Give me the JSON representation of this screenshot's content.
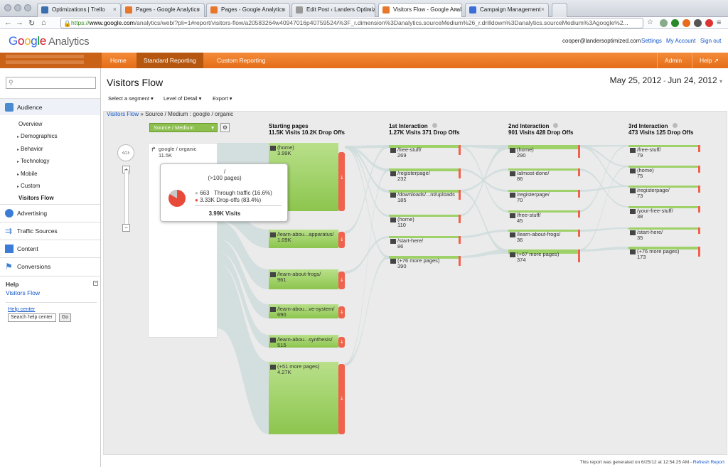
{
  "browser": {
    "tabs": [
      {
        "title": "Optimizations | Trello",
        "color": "#3a6fb0"
      },
      {
        "title": "Pages - Google Analytics",
        "color": "#e8762b"
      },
      {
        "title": "Pages - Google Analytics",
        "color": "#e8762b"
      },
      {
        "title": "Edit Post ‹ Landers Optimize",
        "color": "#999999"
      },
      {
        "title": "Visitors Flow - Google Analy",
        "color": "#e8762b"
      },
      {
        "title": "Campaign Management",
        "color": "#3b6fd6"
      }
    ],
    "url_scheme": "https://",
    "url_domain": "www.google.com",
    "url_rest": "/analytics/web/?pli=1#report/visitors-flow/a20583264w40947016p40759524/%3F_r.dimension%3Danalytics.sourceMedium%26_r.drilldown%3Danalytics.sourceMedium%3Agoogle%2..."
  },
  "header": {
    "logo_google": "Google",
    "logo_analytics": "Analytics",
    "email": "cooper@landersoptimized.com",
    "settings": "Settings",
    "my_account": "My Account",
    "sign_out": "Sign out"
  },
  "nav": {
    "home": "Home",
    "standard_reporting": "Standard Reporting",
    "custom_reporting": "Custom Reporting",
    "admin": "Admin",
    "help": "Help ↗"
  },
  "sidebar": {
    "audience": "Audience",
    "audience_items": [
      {
        "label": "Overview",
        "arrow": ""
      },
      {
        "label": "Demographics",
        "arrow": "▸"
      },
      {
        "label": "Behavior",
        "arrow": "▸"
      },
      {
        "label": "Technology",
        "arrow": "▸"
      },
      {
        "label": "Mobile",
        "arrow": "▸"
      },
      {
        "label": "Custom",
        "arrow": "▸"
      },
      {
        "label": "Visitors Flow",
        "arrow": ""
      }
    ],
    "advertising": "Advertising",
    "traffic_sources": "Traffic Sources",
    "content": "Content",
    "conversions": "Conversions",
    "help_title": "Help",
    "help_link": "Visitors Flow",
    "help_center": "Help center",
    "help_search_placeholder": "Search help center",
    "go": "Go"
  },
  "main": {
    "title": "Visitors Flow",
    "date_start": "May 25, 2012",
    "date_sep": " - ",
    "date_end": "Jun 24, 2012",
    "select_segment": "Select a segment ▾",
    "level_of_detail": "Level of Detail ▾",
    "export": "Export ▾",
    "breadcrumb_link": "Visitors Flow",
    "breadcrumb_rest": " » Source / Medium : google / organic",
    "dimension": "Source / Medium",
    "footer_text": "This report was generated on 6/25/12 at 12:54:25 AM - ",
    "refresh": "Refresh Report"
  },
  "flow": {
    "source": {
      "label": "google / organic",
      "value": "11.5K"
    },
    "columns": [
      {
        "title": "Starting pages",
        "stats": "11.5K Visits 10.2K Drop Offs"
      },
      {
        "title": "1st Interaction",
        "stats": "1.27K Visits 371 Drop Offs"
      },
      {
        "title": "2nd Interaction",
        "stats": "901 Visits 428 Drop Offs"
      },
      {
        "title": "3rd Interaction",
        "stats": "473 Visits 125 Drop Offs"
      }
    ],
    "starting": [
      {
        "page": "(home)",
        "value": "3.99K"
      },
      {
        "page": "/learn-abou...apparatus/",
        "value": "1.09K"
      },
      {
        "page": "/learn-about-frogs/",
        "value": "961"
      },
      {
        "page": "/learn-abou...ve-system/",
        "value": "690"
      },
      {
        "page": "/learn-abou...synthesis/",
        "value": "515"
      },
      {
        "page": "(+51 more pages)",
        "value": "4.27K"
      }
    ],
    "first": [
      {
        "page": "/free-stuff/",
        "value": "269"
      },
      {
        "page": "/registerpage/",
        "value": "232"
      },
      {
        "page": "/downloads/...nt/uploads",
        "value": "185"
      },
      {
        "page": "(home)",
        "value": "110"
      },
      {
        "page": "/start-here/",
        "value": "86"
      },
      {
        "page": "(+76 more pages)",
        "value": "390"
      }
    ],
    "second": [
      {
        "page": "(home)",
        "value": "290"
      },
      {
        "page": "/almost-done/",
        "value": "86"
      },
      {
        "page": "/registerpage/",
        "value": "70"
      },
      {
        "page": "/free-stuff/",
        "value": "45"
      },
      {
        "page": "/learn-about-frogs/",
        "value": "36"
      },
      {
        "page": "(+67 more pages)",
        "value": "374"
      }
    ],
    "third": [
      {
        "page": "/free-stuff/",
        "value": "79"
      },
      {
        "page": "(home)",
        "value": "75"
      },
      {
        "page": "/registerpage/",
        "value": "73"
      },
      {
        "page": "/your-free-stuff/",
        "value": "38"
      },
      {
        "page": "/start-here/",
        "value": "35"
      },
      {
        "page": "(+76 more pages)",
        "value": "173"
      }
    ],
    "tooltip": {
      "title": "/",
      "subtitle": "(>100 pages)",
      "through_value": "663",
      "through_label": "Through traffic (16.6%)",
      "drop_value": "3.33K",
      "drop_label": "Drop-offs (83.4%)",
      "visits": "3.99K Visits",
      "drop_fraction": 0.834
    }
  },
  "colors": {
    "orange": "#e8762b",
    "green": "#a6d36b",
    "red": "#f0624d",
    "link": "#1155cc"
  }
}
